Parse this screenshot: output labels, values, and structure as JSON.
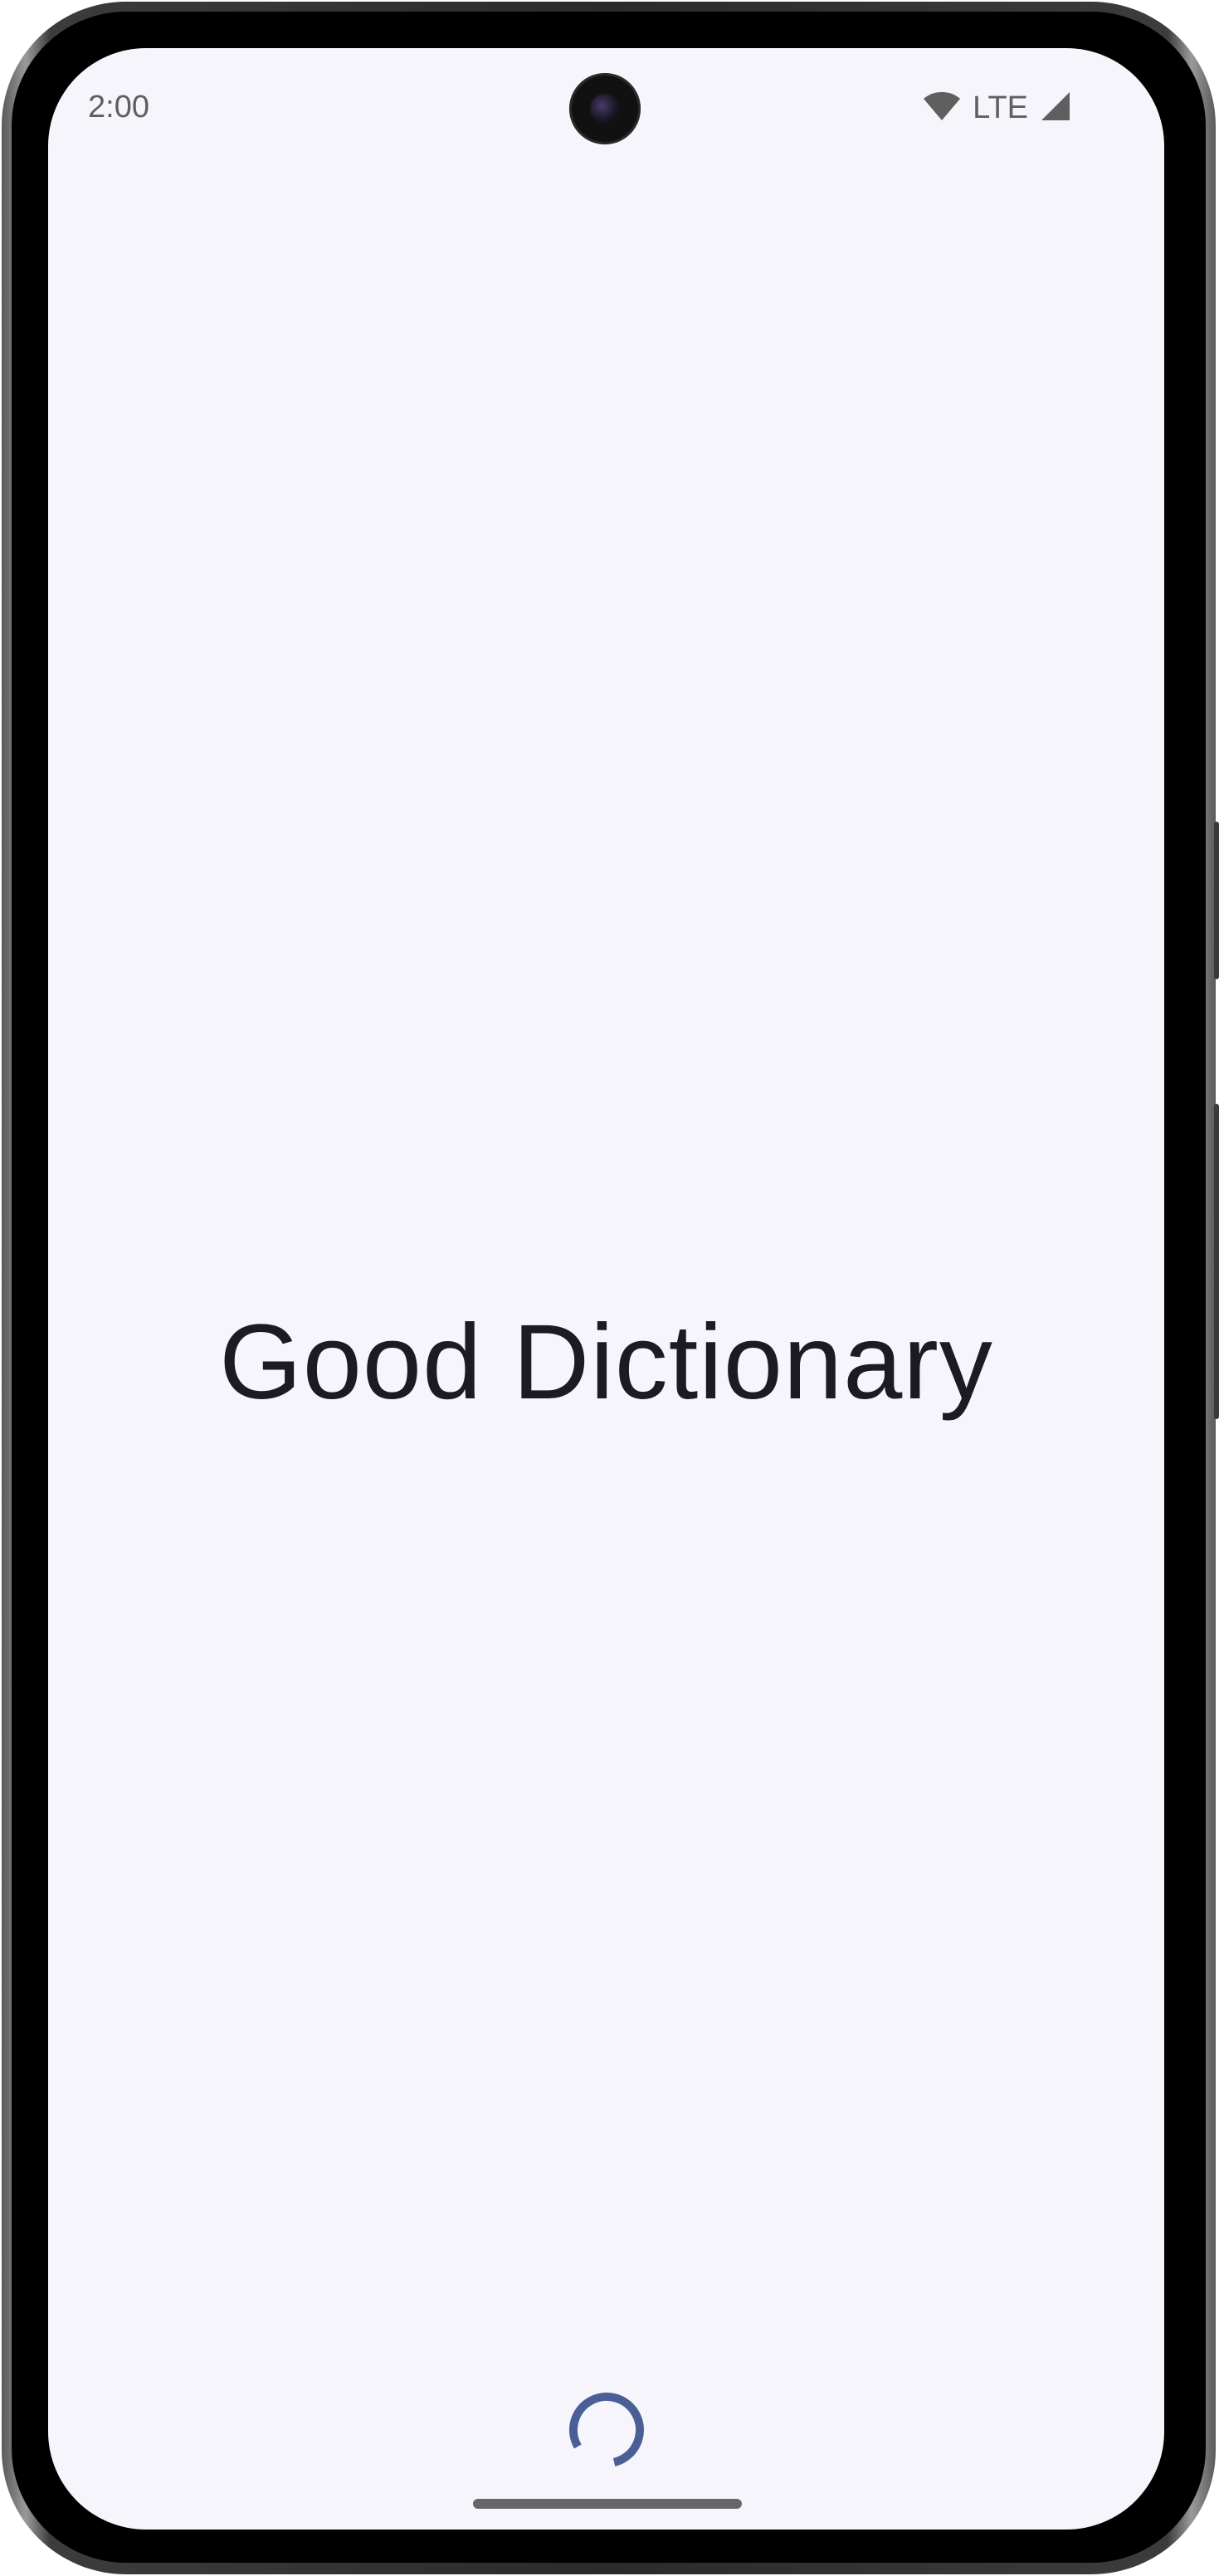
{
  "status_bar": {
    "time": "2:00",
    "network": "LTE",
    "icons": [
      "wifi-icon",
      "cellular-signal-icon"
    ]
  },
  "splash": {
    "app_name": "Good Dictionary",
    "loading": true
  },
  "colors": {
    "background": "#f7f5fc",
    "text": "#1c1b22",
    "spinner": "#4a5f96",
    "status_text": "#5f5f5f"
  }
}
